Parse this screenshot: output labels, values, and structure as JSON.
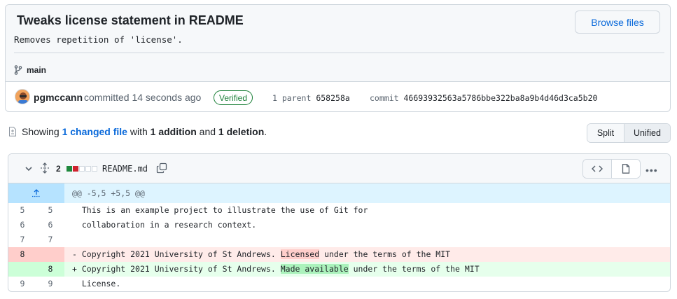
{
  "commit": {
    "title": "Tweaks license statement in README",
    "description": "Removes repetition of 'license'.",
    "browse_label": "Browse files",
    "branch": "main",
    "author": "pgmccann",
    "committed_text": "committed 14 seconds ago",
    "verified_label": "Verified",
    "parent_label": "1 parent",
    "parent_sha": "658258a",
    "commit_label": "commit",
    "commit_sha": "46693932563a5786bbe322ba8a9b4d46d3ca5b20"
  },
  "summary": {
    "showing": "Showing",
    "changed_link": "1 changed file",
    "with": "with",
    "additions": "1 addition",
    "and": "and",
    "deletions": "1 deletion",
    "period": "."
  },
  "view_toggle": {
    "split_label": "Split",
    "unified_label": "Unified",
    "selected": "Unified"
  },
  "file": {
    "change_count": "2",
    "filename": "README.md",
    "diffstat": [
      "green",
      "red",
      "gray",
      "gray",
      "gray"
    ],
    "hunk_header": "@@ -5,5 +5,5 @@",
    "lines": [
      {
        "old": "5",
        "new": "5",
        "type": "context",
        "sign": " ",
        "pre": "This is an example project to illustrate the use of Git for",
        "hl": "",
        "post": ""
      },
      {
        "old": "6",
        "new": "6",
        "type": "context",
        "sign": " ",
        "pre": "collaboration in a research context.",
        "hl": "",
        "post": ""
      },
      {
        "old": "7",
        "new": "7",
        "type": "context",
        "sign": " ",
        "pre": "",
        "hl": "",
        "post": ""
      },
      {
        "old": "8",
        "new": "",
        "type": "del",
        "sign": "-",
        "pre": "Copyright 2021 University of St Andrews. ",
        "hl": "Licensed",
        "post": " under the terms of the MIT"
      },
      {
        "old": "",
        "new": "8",
        "type": "add",
        "sign": "+",
        "pre": "Copyright 2021 University of St Andrews. ",
        "hl": "Made available",
        "post": " under the terms of the MIT"
      },
      {
        "old": "9",
        "new": "9",
        "type": "context",
        "sign": " ",
        "pre": "License.",
        "hl": "",
        "post": ""
      }
    ]
  },
  "colors": {
    "link": "#0969da",
    "verified": "#1a7f37",
    "deletion_bg": "#ffebe9",
    "addition_bg": "#e6ffec",
    "hunk_bg": "#ddf4ff"
  }
}
